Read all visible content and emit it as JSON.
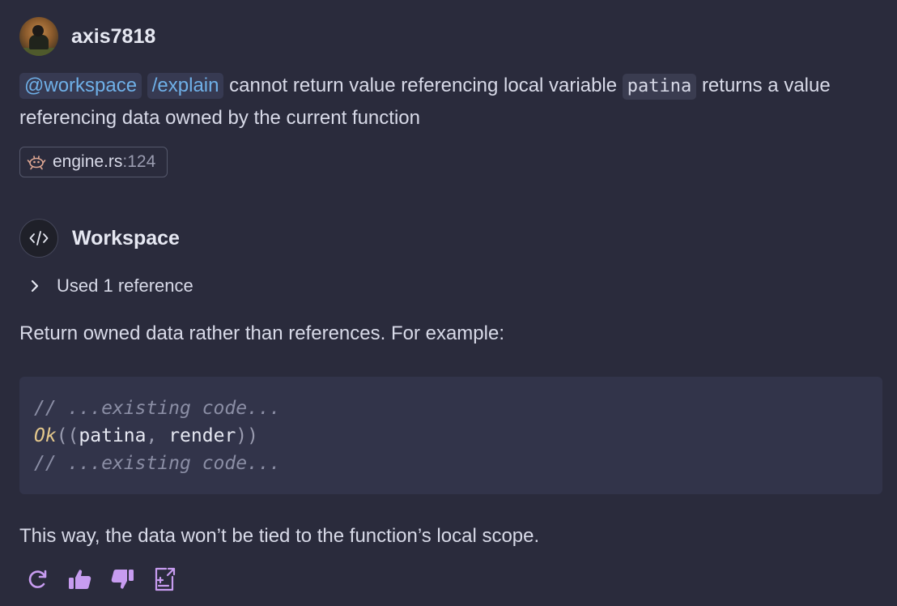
{
  "user": {
    "name": "axis7818",
    "avatar_icon": "user-avatar"
  },
  "prompt": {
    "agent_chip": "@workspace",
    "command_chip": "/explain",
    "text_before_code": "cannot return value referencing local variable",
    "code": "patina",
    "text_after_code": "returns a value referencing data owned by the current function"
  },
  "file_reference": {
    "icon": "rust-icon",
    "filename": "engine.rs",
    "line": ":124"
  },
  "response": {
    "agent_name": "Workspace",
    "agent_icon": "code-icon",
    "references_label": "Used 1 reference",
    "intro": "Return owned data rather than references. For example:",
    "code_lines": {
      "line1": "// ...existing code...",
      "line2_fn": "Ok",
      "line2_open": "((",
      "line2_arg1": "patina",
      "line2_sep": ", ",
      "line2_arg2": "render",
      "line2_close": "))",
      "line3": "// ...existing code..."
    },
    "outro": "This way, the data won’t be tied to the function’s local scope."
  },
  "actions": {
    "accent_color": "#c79cf0",
    "icons": [
      "refresh-icon",
      "thumbs-up-icon",
      "thumbs-down-icon",
      "insert-into-file-icon"
    ]
  },
  "colors": {
    "background": "#2a2b3c",
    "chip_text": "#6fb0e8",
    "code_background": "#32344a"
  }
}
